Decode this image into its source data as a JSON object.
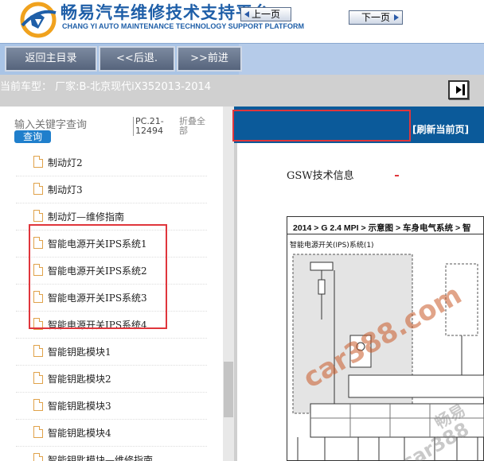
{
  "header": {
    "title": "畅易汽车维修技术支持平台",
    "subtitle": "CHANG YI AUTO MAINTENANCE TECHNOLOGY SUPPORT PLATFORM"
  },
  "nav": {
    "home_label": "返回主目录",
    "back_label": "<<后退.",
    "forward_label": ">>前进"
  },
  "vehicle": {
    "label": "当前车型：  厂家:B-北京现代iX352013-2014"
  },
  "search": {
    "placeholder": "输入关键字查询",
    "button_label": "查询"
  },
  "doc_code": "PC.21-12494",
  "collapse_label": "折叠全部",
  "tree_items": [
    "制动灯2",
    "制动灯3",
    "制动灯—维修指南",
    "智能电源开关IPS系统1",
    "智能电源开关IPS系统2",
    "智能电源开关IPS系统3",
    "智能电源开关IPS系统4",
    "智能钥匙模块1",
    "智能钥匙模块2",
    "智能钥匙模块3",
    "智能钥匙模块4",
    "智能钥匙模块—维修指南"
  ],
  "pager": {
    "prev_label": "上一页",
    "next_label": "下一页",
    "refresh_label": "[刷新当前页]"
  },
  "document": {
    "heading": "GSW技术信息",
    "breadcrumb": "2014 > G 2.4 MPI > 示意图 > 车身电气系统 > 智",
    "subtitle": "智能电源开关(IPS)系统(1)"
  },
  "watermark": {
    "primary": "car388.com",
    "secondary_a": "畅易",
    "secondary_b": "car388"
  },
  "colors": {
    "brand_blue": "#1f5fa8",
    "nav_bar": "#a9c4e6",
    "pager_bar": "#0b5a9a",
    "highlight_red": "#e0363c",
    "doc_icon": "#e0a24a"
  }
}
